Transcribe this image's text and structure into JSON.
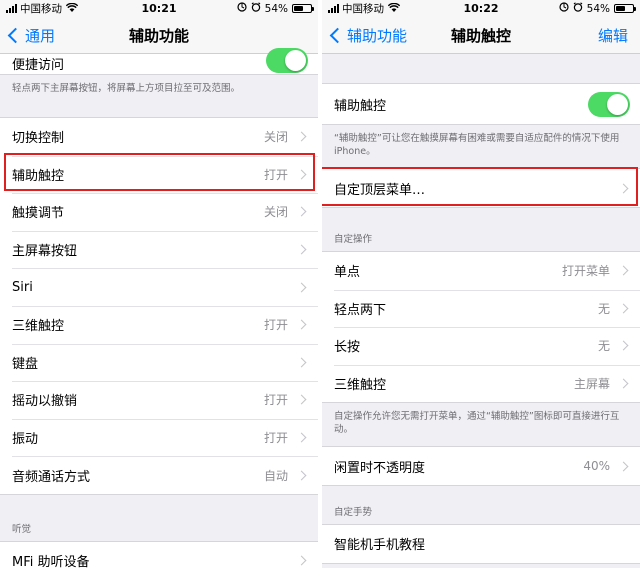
{
  "left": {
    "status": {
      "carrier": "中国移动",
      "time": "10:21",
      "battery": "54%",
      "battery_level": 0.54
    },
    "nav": {
      "back": "通用",
      "title": "辅助功能"
    },
    "top_row": {
      "label": "便捷访问",
      "toggle_on": true
    },
    "top_note": "轻点两下主屏幕按钮，将屏幕上方项目拉至可及范围。",
    "rows": [
      {
        "label": "切换控制",
        "value": "关闭"
      },
      {
        "label": "辅助触控",
        "value": "打开"
      },
      {
        "label": "触摸调节",
        "value": "关闭"
      },
      {
        "label": "主屏幕按钮",
        "value": ""
      },
      {
        "label": "Siri",
        "value": ""
      },
      {
        "label": "三维触控",
        "value": "打开"
      },
      {
        "label": "键盘",
        "value": ""
      },
      {
        "label": "摇动以撤销",
        "value": "打开"
      },
      {
        "label": "振动",
        "value": "打开"
      },
      {
        "label": "音频通话方式",
        "value": "自动"
      }
    ],
    "hearing_header": "听觉",
    "hearing_rows": [
      {
        "label": "MFi 助听设备",
        "value": ""
      }
    ]
  },
  "right": {
    "status": {
      "carrier": "中国移动",
      "time": "10:22",
      "battery": "54%",
      "battery_level": 0.54
    },
    "nav": {
      "back": "辅助功能",
      "title": "辅助触控",
      "action": "编辑"
    },
    "toggle_row": {
      "label": "辅助触控",
      "toggle_on": true
    },
    "toggle_note": "“辅助触控”可让您在触摸屏幕有困难或需要自适应配件的情况下使用 iPhone。",
    "menu_row": {
      "label": "自定顶层菜单…"
    },
    "custom_actions_header": "自定操作",
    "custom_actions": [
      {
        "label": "单点",
        "value": "打开菜单"
      },
      {
        "label": "轻点两下",
        "value": "无"
      },
      {
        "label": "长按",
        "value": "无"
      },
      {
        "label": "三维触控",
        "value": "主屏幕"
      }
    ],
    "custom_actions_note": "自定操作允许您无需打开菜单，通过“辅助触控”图标即可直接进行互动。",
    "opacity_row": {
      "label": "闲置时不透明度",
      "value": "40%"
    },
    "gestures_header": "自定手势",
    "gesture_rows": [
      {
        "label": "智能机手机教程"
      }
    ]
  },
  "colors": {
    "accent": "#007aff",
    "toggle_on": "#4cd964",
    "highlight": "#e02020",
    "background": "#efeff4"
  }
}
